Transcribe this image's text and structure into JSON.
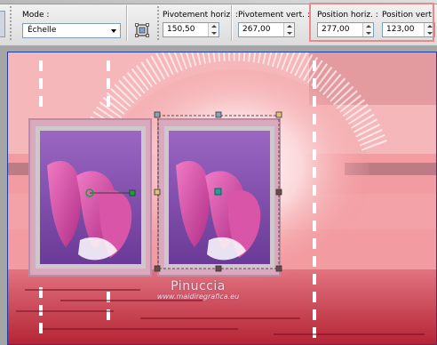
{
  "toolbar": {
    "mode": {
      "label": "Mode :",
      "value": "Échelle"
    },
    "pivot_h": {
      "label": "Pivotement horiz. :",
      "value": "150,50"
    },
    "pivot_v": {
      "label": "Pivotement vert. :",
      "value": "267,00"
    },
    "pos_h": {
      "label": "Position horiz. :",
      "value": "277,00"
    },
    "pos_v": {
      "label": "Position vert. :",
      "value": "123,00"
    },
    "icons": [
      "perspective-icon"
    ],
    "highlight_color": "#e88a8a"
  },
  "canvas": {
    "watermark_name": "Pinuccia",
    "watermark_url": "www.maidiregrafica.eu",
    "colors": {
      "pink_bg": "#f08f94",
      "frame_border": "#c8a6b8",
      "lily": "#c8459a",
      "lily_bg": "#7b3fa0",
      "node_green": "#1e9e3a"
    }
  }
}
